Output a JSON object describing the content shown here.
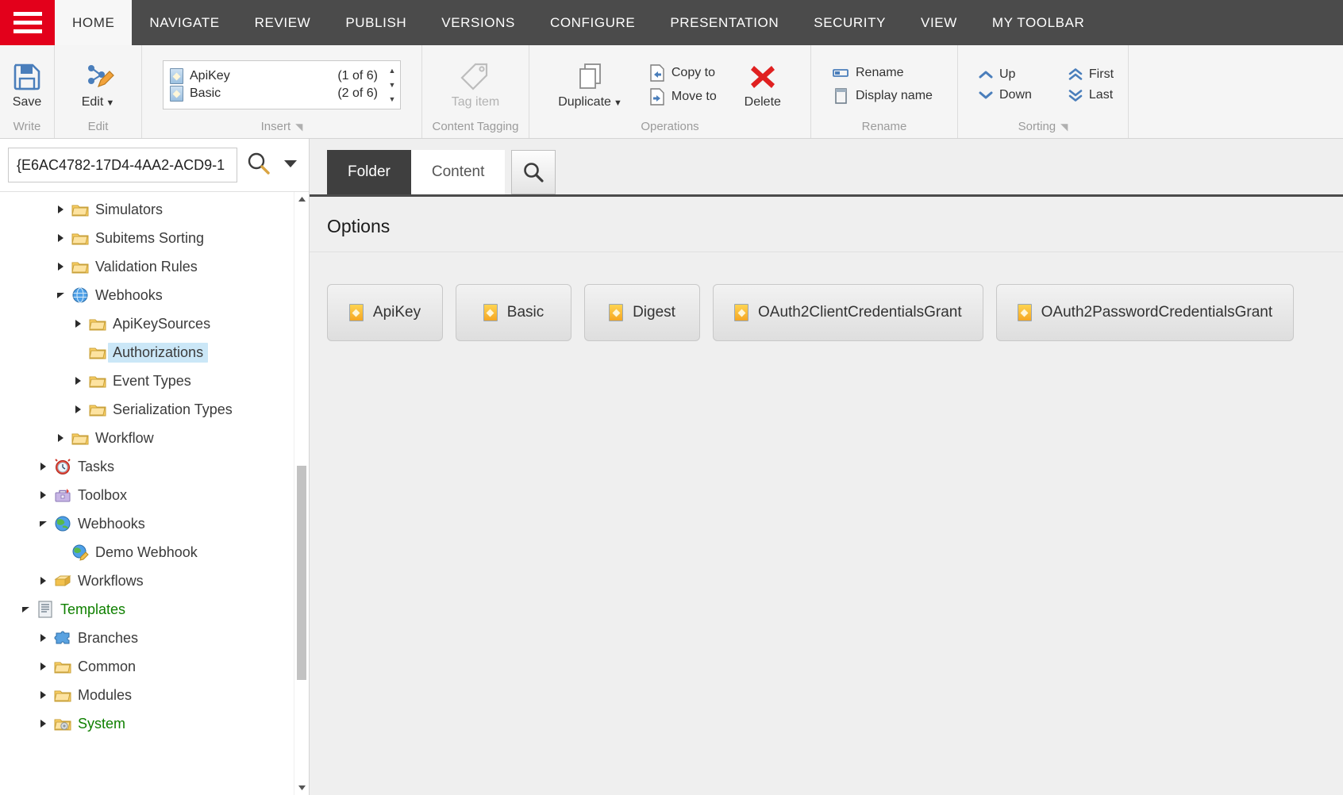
{
  "ribbon": {
    "tabs": [
      {
        "label": "HOME",
        "active": true
      },
      {
        "label": "NAVIGATE",
        "active": false
      },
      {
        "label": "REVIEW",
        "active": false
      },
      {
        "label": "PUBLISH",
        "active": false
      },
      {
        "label": "VERSIONS",
        "active": false
      },
      {
        "label": "CONFIGURE",
        "active": false
      },
      {
        "label": "PRESENTATION",
        "active": false
      },
      {
        "label": "SECURITY",
        "active": false
      },
      {
        "label": "VIEW",
        "active": false
      },
      {
        "label": "MY TOOLBAR",
        "active": false
      }
    ],
    "chunks": {
      "write": {
        "label": "Write",
        "save_label": "Save"
      },
      "edit": {
        "label": "Edit",
        "edit_label": "Edit"
      },
      "insert": {
        "label": "Insert",
        "items": [
          {
            "name": "ApiKey",
            "count": "(1 of 6)"
          },
          {
            "name": "Basic",
            "count": "(2 of 6)"
          }
        ]
      },
      "content_tagging": {
        "label": "Content Tagging",
        "tag_item_label": "Tag item"
      },
      "operations": {
        "label": "Operations",
        "duplicate_label": "Duplicate",
        "copy_to_label": "Copy to",
        "move_to_label": "Move to",
        "delete_label": "Delete"
      },
      "rename": {
        "label": "Rename",
        "rename_label": "Rename",
        "display_name_label": "Display name"
      },
      "sorting": {
        "label": "Sorting",
        "up_label": "Up",
        "down_label": "Down",
        "first_label": "First",
        "last_label": "Last"
      }
    }
  },
  "tree": {
    "search_value": "{E6AC4782-17D4-4AA2-ACD9-1",
    "search_placeholder": "Search",
    "items": [
      {
        "label": "Simulators",
        "indent": 3,
        "twisty": "collapsed",
        "icon": "folder",
        "state": "normal"
      },
      {
        "label": "Subitems Sorting",
        "indent": 3,
        "twisty": "collapsed",
        "icon": "folder",
        "state": "normal"
      },
      {
        "label": "Validation Rules",
        "indent": 3,
        "twisty": "collapsed",
        "icon": "folder",
        "state": "normal"
      },
      {
        "label": "Webhooks",
        "indent": 3,
        "twisty": "expanded",
        "icon": "globe-blue",
        "state": "normal"
      },
      {
        "label": "ApiKeySources",
        "indent": 4,
        "twisty": "collapsed",
        "icon": "folder",
        "state": "normal"
      },
      {
        "label": "Authorizations",
        "indent": 4,
        "twisty": "none",
        "icon": "folder",
        "state": "selected"
      },
      {
        "label": "Event Types",
        "indent": 4,
        "twisty": "collapsed",
        "icon": "folder",
        "state": "normal"
      },
      {
        "label": "Serialization Types",
        "indent": 4,
        "twisty": "collapsed",
        "icon": "folder",
        "state": "normal"
      },
      {
        "label": "Workflow",
        "indent": 3,
        "twisty": "collapsed",
        "icon": "folder",
        "state": "normal"
      },
      {
        "label": "Tasks",
        "indent": 2,
        "twisty": "collapsed",
        "icon": "clock",
        "state": "normal"
      },
      {
        "label": "Toolbox",
        "indent": 2,
        "twisty": "collapsed",
        "icon": "toolbox",
        "state": "normal"
      },
      {
        "label": "Webhooks",
        "indent": 2,
        "twisty": "expanded",
        "icon": "globe-green",
        "state": "normal"
      },
      {
        "label": "Demo Webhook",
        "indent": 3,
        "twisty": "none",
        "icon": "globe-pencil",
        "state": "normal"
      },
      {
        "label": "Workflows",
        "indent": 2,
        "twisty": "collapsed",
        "icon": "workflow",
        "state": "normal"
      },
      {
        "label": "Templates",
        "indent": 1,
        "twisty": "expanded",
        "icon": "template",
        "state": "green"
      },
      {
        "label": "Branches",
        "indent": 2,
        "twisty": "collapsed",
        "icon": "puzzle",
        "state": "normal"
      },
      {
        "label": "Common",
        "indent": 2,
        "twisty": "collapsed",
        "icon": "folder",
        "state": "normal"
      },
      {
        "label": "Modules",
        "indent": 2,
        "twisty": "collapsed",
        "icon": "folder",
        "state": "normal"
      },
      {
        "label": "System",
        "indent": 2,
        "twisty": "collapsed",
        "icon": "folder-gear",
        "state": "green"
      }
    ]
  },
  "editor": {
    "tabs": [
      {
        "label": "Folder",
        "active": true
      },
      {
        "label": "Content",
        "active": false
      }
    ],
    "search_icon": "magnifier-icon",
    "section_title": "Options",
    "options": [
      {
        "label": "ApiKey"
      },
      {
        "label": "Basic"
      },
      {
        "label": "Digest"
      },
      {
        "label": "OAuth2ClientCredentialsGrant"
      },
      {
        "label": "OAuth2PasswordCredentialsGrant"
      }
    ]
  },
  "colors": {
    "brand_red": "#e3001b",
    "ribbon_dark": "#4b4b4b",
    "selection_blue": "#cbe7f7",
    "green_text": "#0f8000"
  }
}
